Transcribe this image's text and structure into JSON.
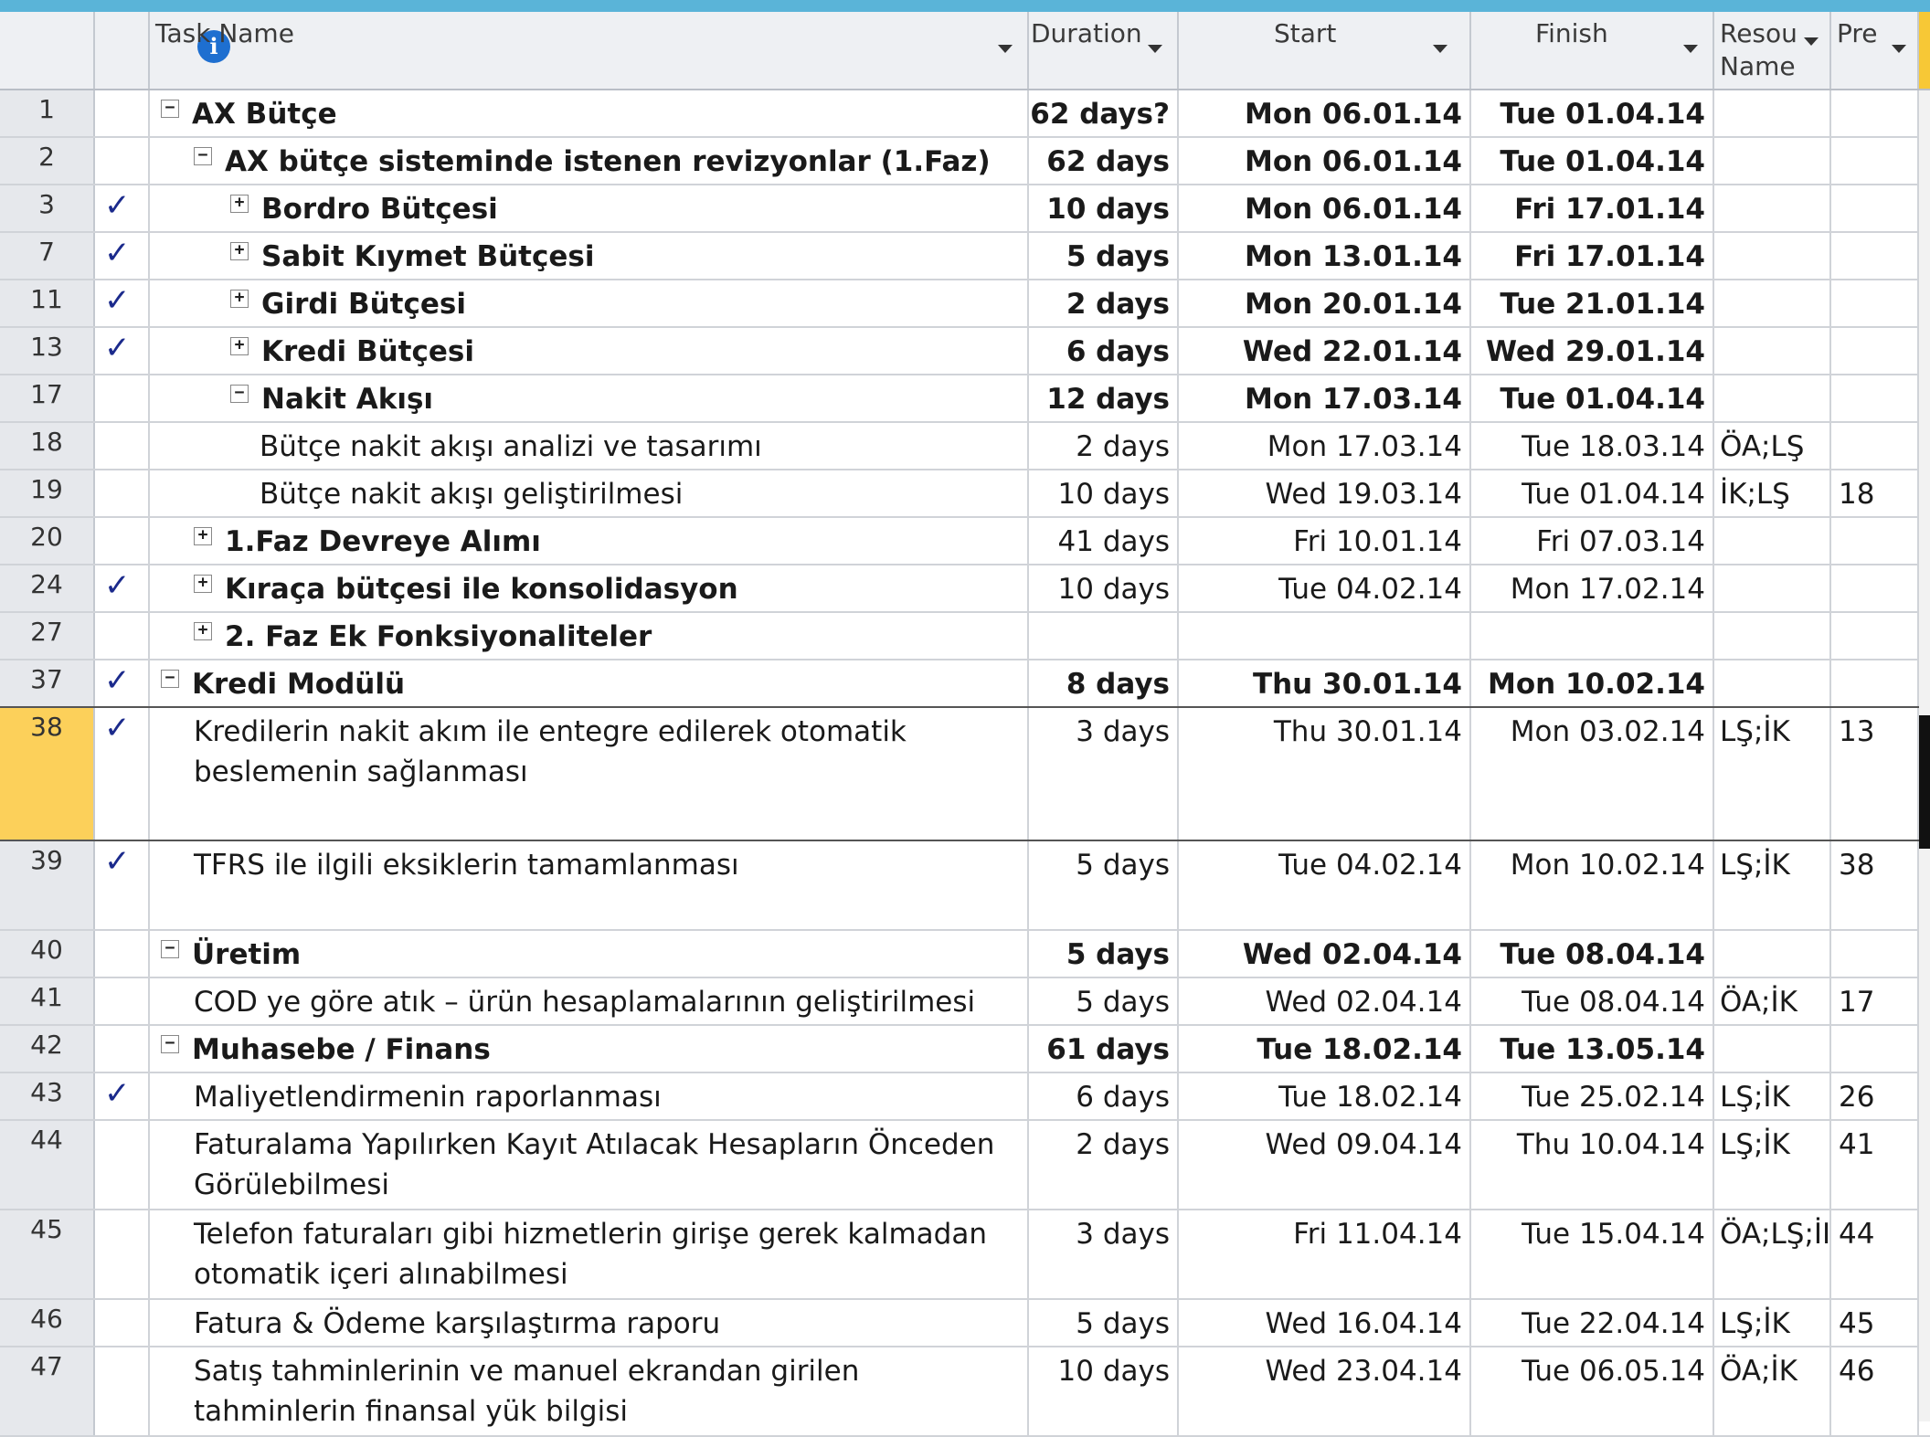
{
  "header": {
    "task_name": "Task Name",
    "duration": "Duration",
    "start": "Start",
    "finish": "Finish",
    "resource_line1": "Resou",
    "resource_line2": "Name",
    "predecessors": "Pre",
    "info_icon": "i"
  },
  "rows": [
    {
      "id": "1",
      "name": "AX Bütçe",
      "duration": "62 days?",
      "start": "Mon 06.01.14",
      "finish": "Tue 01.04.14",
      "resource": "",
      "pred": "",
      "bold": true,
      "level": 0,
      "toggle": "−",
      "done": false
    },
    {
      "id": "2",
      "name": "AX bütçe sisteminde istenen revizyonlar (1.Faz)",
      "duration": "62 days",
      "start": "Mon 06.01.14",
      "finish": "Tue 01.04.14",
      "resource": "",
      "pred": "",
      "bold": true,
      "level": 1,
      "toggle": "−",
      "done": false
    },
    {
      "id": "3",
      "name": "Bordro Bütçesi",
      "duration": "10 days",
      "start": "Mon 06.01.14",
      "finish": "Fri 17.01.14",
      "resource": "",
      "pred": "",
      "bold": true,
      "level": 2,
      "toggle": "+",
      "done": true
    },
    {
      "id": "7",
      "name": "Sabit Kıymet Bütçesi",
      "duration": "5 days",
      "start": "Mon 13.01.14",
      "finish": "Fri 17.01.14",
      "resource": "",
      "pred": "",
      "bold": true,
      "level": 2,
      "toggle": "+",
      "done": true
    },
    {
      "id": "11",
      "name": "Girdi Bütçesi",
      "duration": "2 days",
      "start": "Mon 20.01.14",
      "finish": "Tue 21.01.14",
      "resource": "",
      "pred": "",
      "bold": true,
      "level": 2,
      "toggle": "+",
      "done": true
    },
    {
      "id": "13",
      "name": "Kredi Bütçesi",
      "duration": "6 days",
      "start": "Wed 22.01.14",
      "finish": "Wed 29.01.14",
      "resource": "",
      "pred": "",
      "bold": true,
      "level": 2,
      "toggle": "+",
      "done": true
    },
    {
      "id": "17",
      "name": "Nakit Akışı",
      "duration": "12 days",
      "start": "Mon 17.03.14",
      "finish": "Tue 01.04.14",
      "resource": "",
      "pred": "",
      "bold": true,
      "level": 2,
      "toggle": "−",
      "done": false
    },
    {
      "id": "18",
      "name": "Bütçe nakit akışı analizi ve tasarımı",
      "duration": "2 days",
      "start": "Mon 17.03.14",
      "finish": "Tue 18.03.14",
      "resource": "ÖA;LŞ",
      "pred": "",
      "bold": false,
      "level": 3,
      "toggle": "",
      "done": false
    },
    {
      "id": "19",
      "name": "Bütçe nakit akışı geliştirilmesi",
      "duration": "10 days",
      "start": "Wed 19.03.14",
      "finish": "Tue 01.04.14",
      "resource": "İK;LŞ",
      "pred": "18",
      "bold": false,
      "level": 3,
      "toggle": "",
      "done": false
    },
    {
      "id": "20",
      "name": "1.Faz Devreye Alımı",
      "duration": "41 days",
      "start": "Fri 10.01.14",
      "finish": "Fri 07.03.14",
      "resource": "",
      "pred": "",
      "bold": true,
      "level": 1,
      "toggle": "+",
      "done": false,
      "plainvals": true
    },
    {
      "id": "24",
      "name": "Kıraça bütçesi ile konsolidasyon",
      "duration": "10 days",
      "start": "Tue 04.02.14",
      "finish": "Mon 17.02.14",
      "resource": "",
      "pred": "",
      "bold": true,
      "level": 1,
      "toggle": "+",
      "done": true,
      "plainvals": true
    },
    {
      "id": "27",
      "name": "2. Faz Ek Fonksiyonaliteler",
      "duration": "",
      "start": "",
      "finish": "",
      "resource": "",
      "pred": "",
      "bold": true,
      "level": 1,
      "toggle": "+",
      "done": false
    },
    {
      "id": "37",
      "name": "Kredi Modülü",
      "duration": "8 days",
      "start": "Thu 30.01.14",
      "finish": "Mon 10.02.14",
      "resource": "",
      "pred": "",
      "bold": true,
      "level": 0,
      "toggle": "−",
      "done": true
    },
    {
      "id": "38",
      "name_lines": [
        "Kredilerin nakit akım ile entegre edilerek otomatik",
        "beslemenin sağlanması"
      ],
      "duration": "3 days",
      "start": "Thu 30.01.14",
      "finish": "Mon 03.02.14",
      "resource": "LŞ;İK",
      "pred": "13",
      "bold": false,
      "level": 1,
      "toggle": "",
      "done": true,
      "selected": true
    },
    {
      "id": "39",
      "name": "TFRS ile ilgili eksiklerin tamamlanması",
      "duration": "5 days",
      "start": "Tue 04.02.14",
      "finish": "Mon 10.02.14",
      "resource": "LŞ;İK",
      "pred": "38",
      "bold": false,
      "level": 1,
      "toggle": "",
      "done": true
    },
    {
      "id": "40",
      "name": "Üretim",
      "duration": "5 days",
      "start": "Wed 02.04.14",
      "finish": "Tue 08.04.14",
      "resource": "",
      "pred": "",
      "bold": true,
      "level": 0,
      "toggle": "−",
      "done": false
    },
    {
      "id": "41",
      "name": "COD ye göre atık – ürün hesaplamalarının geliştirilmesi",
      "duration": "5 days",
      "start": "Wed 02.04.14",
      "finish": "Tue 08.04.14",
      "resource": "ÖA;İK",
      "pred": "17",
      "bold": false,
      "level": 1,
      "toggle": "",
      "done": false
    },
    {
      "id": "42",
      "name": "Muhasebe / Finans",
      "duration": "61 days",
      "start": "Tue 18.02.14",
      "finish": "Tue 13.05.14",
      "resource": "",
      "pred": "",
      "bold": true,
      "level": 0,
      "toggle": "−",
      "done": false
    },
    {
      "id": "43",
      "name": "Maliyetlendirmenin raporlanması",
      "duration": "6 days",
      "start": "Tue 18.02.14",
      "finish": "Tue 25.02.14",
      "resource": "LŞ;İK",
      "pred": "26",
      "bold": false,
      "level": 1,
      "toggle": "",
      "done": true
    },
    {
      "id": "44",
      "name_lines": [
        "Faturalama Yapılırken Kayıt Atılacak Hesapların Önceden",
        "Görülebilmesi"
      ],
      "duration": "2 days",
      "start": "Wed 09.04.14",
      "finish": "Thu 10.04.14",
      "resource": "LŞ;İK",
      "pred": "41",
      "bold": false,
      "level": 1,
      "toggle": "",
      "done": false
    },
    {
      "id": "45",
      "name_lines": [
        "Telefon faturaları gibi hizmetlerin girişe gerek kalmadan",
        "otomatik içeri alınabilmesi"
      ],
      "duration": "3 days",
      "start": "Fri 11.04.14",
      "finish": "Tue 15.04.14",
      "resource": "ÖA;LŞ;İI",
      "pred": "44",
      "bold": false,
      "level": 1,
      "toggle": "",
      "done": false
    },
    {
      "id": "46",
      "name": "Fatura & Ödeme karşılaştırma raporu",
      "duration": "5 days",
      "start": "Wed 16.04.14",
      "finish": "Tue 22.04.14",
      "resource": "LŞ;İK",
      "pred": "45",
      "bold": false,
      "level": 1,
      "toggle": "",
      "done": false
    },
    {
      "id": "47",
      "name_lines": [
        "Satış tahminlerinin ve manuel ekrandan girilen",
        "tahminlerin finansal yük bilgisi"
      ],
      "duration": "10 days",
      "start": "Wed 23.04.14",
      "finish": "Tue 06.05.14",
      "resource": "ÖA;İK",
      "pred": "46",
      "bold": false,
      "level": 1,
      "toggle": "",
      "done": false
    }
  ],
  "colors": {
    "selected_row": "#fcd05a",
    "header_bg": "#eef0f3",
    "checkmark": "#1b2a8c",
    "title_bar": "#5ab4d8"
  }
}
